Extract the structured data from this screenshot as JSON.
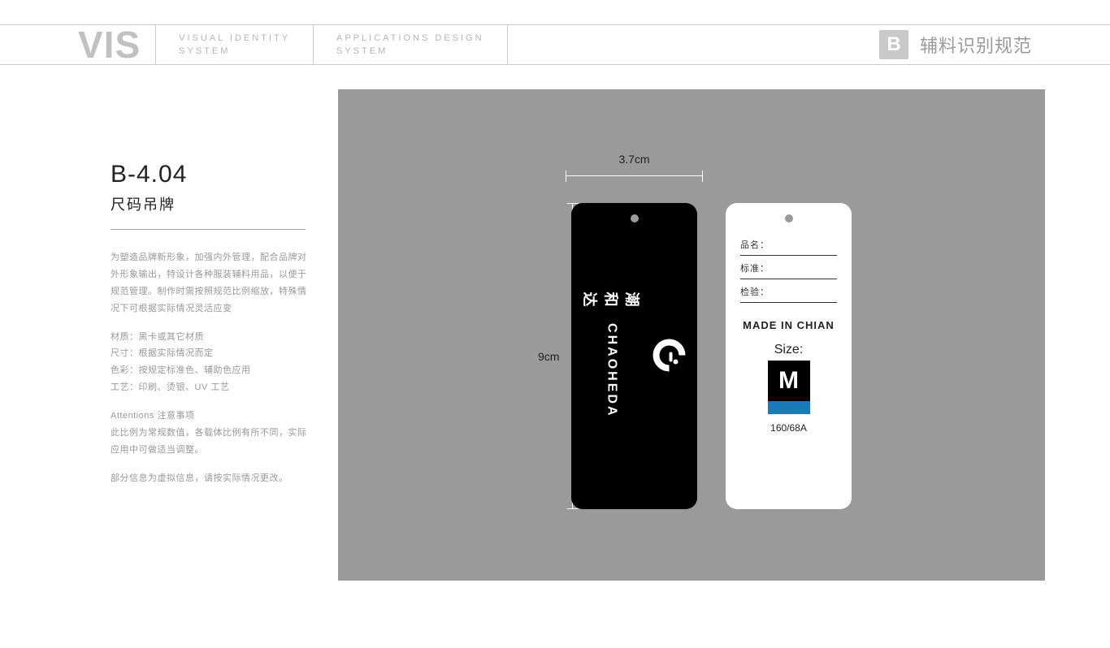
{
  "header": {
    "vis": "VIS",
    "col1_line1": "VISUAL IDENTITY",
    "col1_line2": "SYSTEM",
    "col2_line1": "APPLICATIONS DESIGN",
    "col2_line2": "SYSTEM",
    "badge": "B",
    "title": "辅料识别规范"
  },
  "left": {
    "code": "B-4.04",
    "subtitle": "尺码吊牌",
    "para1": "为塑造品牌新形象，加强内外管理，配合品牌对外形象输出，特设计各种服装辅料用品，以便于规范管理。制作时需按照规范比例缩放，特殊情况下可根据实际情况灵活应变",
    "spec1": "材质：黑卡或其它材质",
    "spec2": "尺寸：根据实际情况而定",
    "spec3": "色彩：按规定标准色、辅助色应用",
    "spec4": "工艺：印刷、烫银、UV 工艺",
    "att_title": "Attentions 注意事项",
    "att_body": "此比例为常规数值，各载体比例有所不同，实际应用中可做适当调整。",
    "note": "部分信息为虚拟信息，请按实际情况更改。"
  },
  "dims": {
    "width": "3.7cm",
    "height": "9cm"
  },
  "tag_black": {
    "logo_cn": "潮和达",
    "logo_en": "CHAOHEDA"
  },
  "tag_white": {
    "field1": "品名：",
    "field2": "标准：",
    "field3": "检验：",
    "made": "MADE IN CHIAN",
    "size_label": "Size:",
    "size_value": "M",
    "size_spec": "160/68A"
  }
}
